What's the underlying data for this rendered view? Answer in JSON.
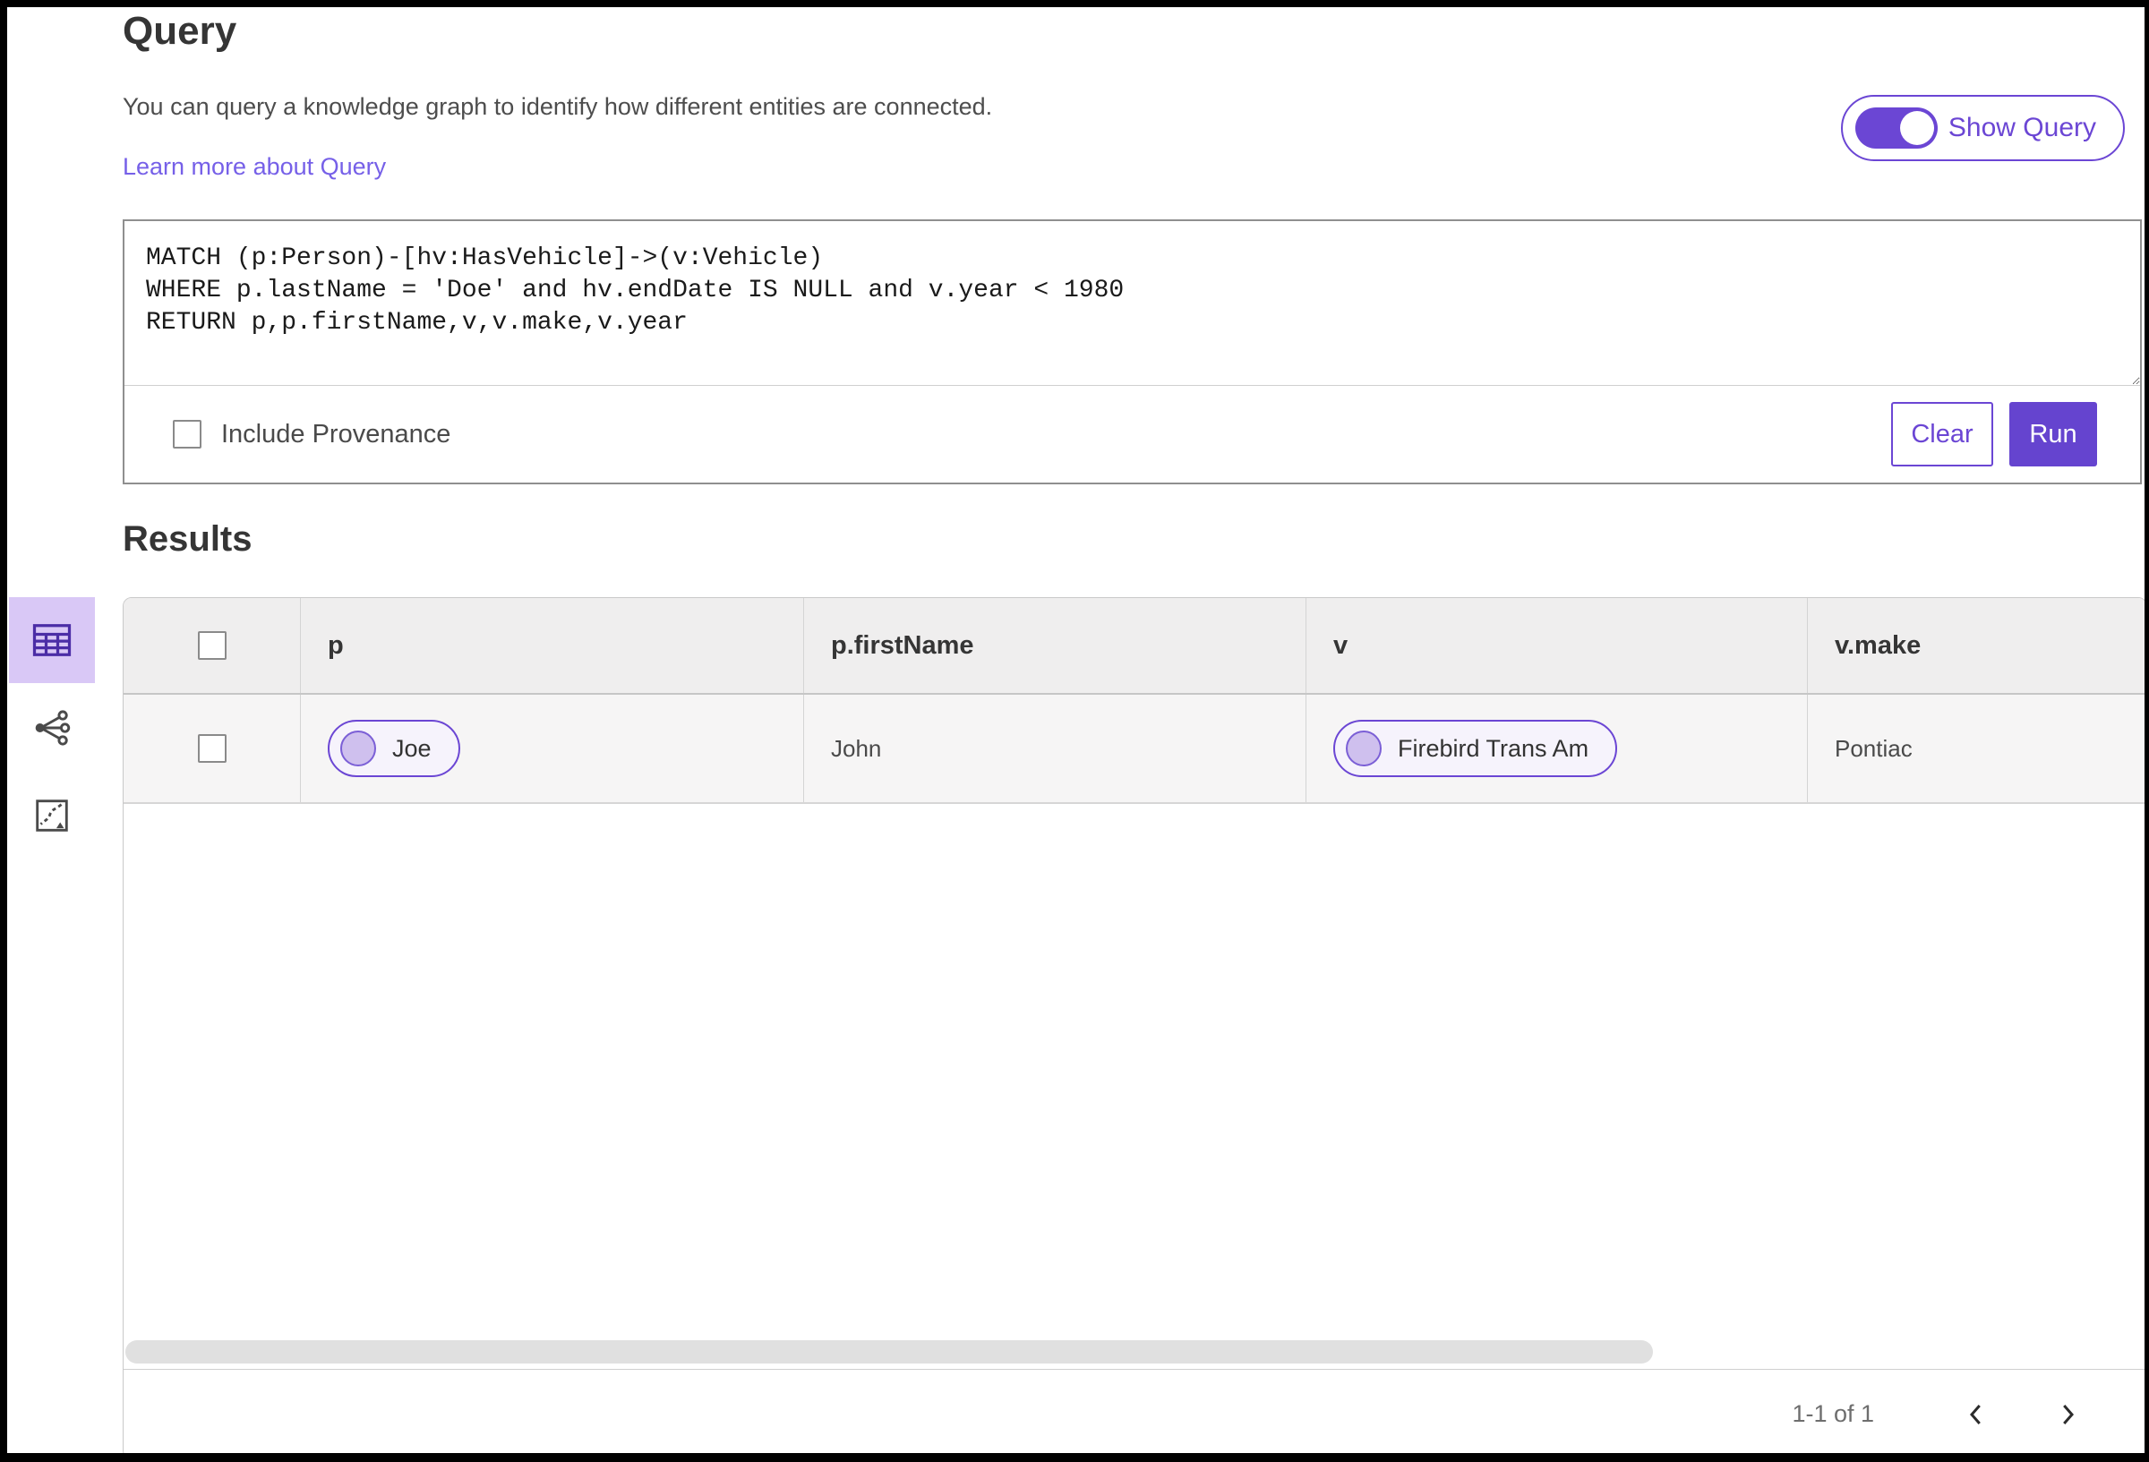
{
  "page": {
    "title": "Query",
    "description": "You can query a knowledge graph to identify how different entities are connected.",
    "learn_more_link": "Learn more about Query"
  },
  "show_query_toggle": {
    "label": "Show Query",
    "state": "on"
  },
  "query_editor": {
    "code": "MATCH (p:Person)-[hv:HasVehicle]->(v:Vehicle)\nWHERE p.lastName = 'Doe' and hv.endDate IS NULL and v.year < 1980\nRETURN p,p.firstName,v,v.make,v.year",
    "include_provenance_label": "Include Provenance",
    "include_provenance_checked": false,
    "clear_button_label": "Clear",
    "run_button_label": "Run"
  },
  "results": {
    "title": "Results",
    "view_tools": [
      {
        "name": "table-view",
        "icon": "table-icon",
        "selected": true
      },
      {
        "name": "link-chart-view",
        "icon": "link-chart-icon",
        "selected": false
      },
      {
        "name": "map-view",
        "icon": "map-icon",
        "selected": false
      }
    ],
    "table": {
      "columns": [
        "p",
        "p.firstName",
        "v",
        "v.make"
      ],
      "rows": [
        {
          "p_pill": "Joe",
          "p_firstName": "John",
          "v_pill": "Firebird Trans Am",
          "v_make": "Pontiac"
        }
      ],
      "pagination": {
        "range_label": "1-1 of 1"
      }
    }
  },
  "colors": {
    "accent_purple": "#6b46d4",
    "selected_tool_background": "#d9c8f6",
    "pill_background": "#f6f3fc",
    "header_row_background": "#efeeee",
    "data_row_background": "#f6f5f5"
  }
}
